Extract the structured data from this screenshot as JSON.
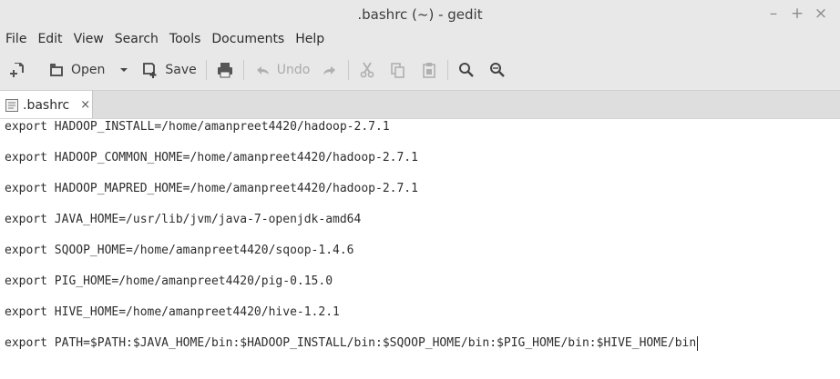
{
  "window": {
    "title": ".bashrc (~) - gedit",
    "controls": [
      "–",
      "+",
      "×"
    ]
  },
  "menu": [
    "File",
    "Edit",
    "View",
    "Search",
    "Tools",
    "Documents",
    "Help"
  ],
  "toolbar": {
    "open_label": "Open",
    "save_label": "Save",
    "undo_label": "Undo"
  },
  "tab": {
    "label": ".bashrc",
    "close": "×"
  },
  "editor": {
    "lines": [
      "export HADOOP_INSTALL=/home/amanpreet4420/hadoop-2.7.1",
      "export HADOOP_COMMON_HOME=/home/amanpreet4420/hadoop-2.7.1",
      "export HADOOP_MAPRED_HOME=/home/amanpreet4420/hadoop-2.7.1",
      "export JAVA_HOME=/usr/lib/jvm/java-7-openjdk-amd64",
      "export SQOOP_HOME=/home/amanpreet4420/sqoop-1.4.6",
      "export PIG_HOME=/home/amanpreet4420/pig-0.15.0",
      "export HIVE_HOME=/home/amanpreet4420/hive-1.2.1",
      "export PATH=$PATH:$JAVA_HOME/bin:$HADOOP_INSTALL/bin:$SQOOP_HOME/bin:$PIG_HOME/bin:$HIVE_HOME/bin"
    ]
  }
}
